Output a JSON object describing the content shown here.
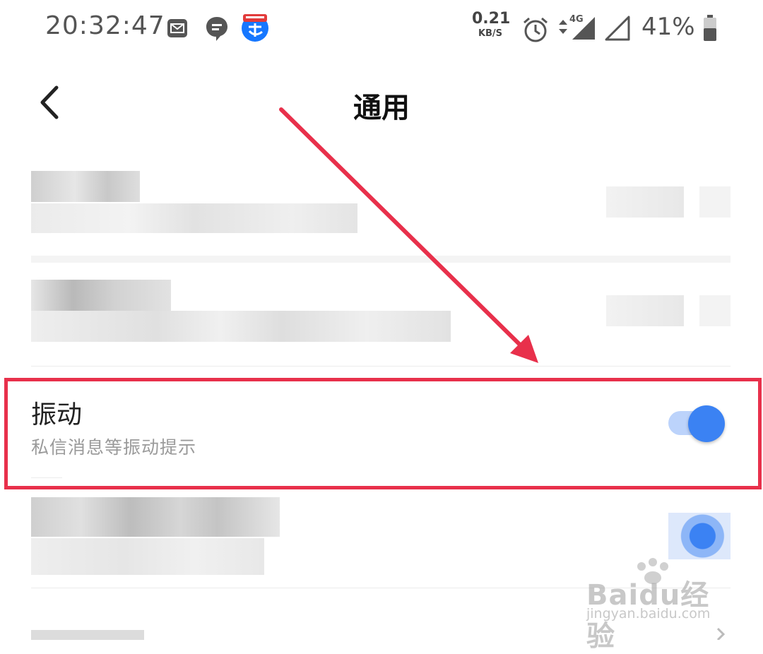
{
  "status_bar": {
    "time": "20:32:47",
    "net_speed": "0.21",
    "net_speed_unit": "KB/S",
    "network_type": "4G",
    "battery_percent": "41%",
    "icons": [
      "mail-icon",
      "chat-bubble-icon",
      "alipay-icon",
      "alarm-icon",
      "data-transfer-icon",
      "signal-icon",
      "battery-icon"
    ]
  },
  "nav": {
    "title": "通用",
    "back_icon": "chevron-left-icon"
  },
  "settings": {
    "vibration": {
      "title": "振动",
      "subtitle": "私信消息等振动提示",
      "enabled": true
    }
  },
  "watermark": {
    "brand": "Baidu经验",
    "url": "jingyan.baidu.com"
  },
  "colors": {
    "toggle_on": "#3b82f3",
    "toggle_track": "#bcd3fb",
    "annotation_red": "#e8304b"
  }
}
